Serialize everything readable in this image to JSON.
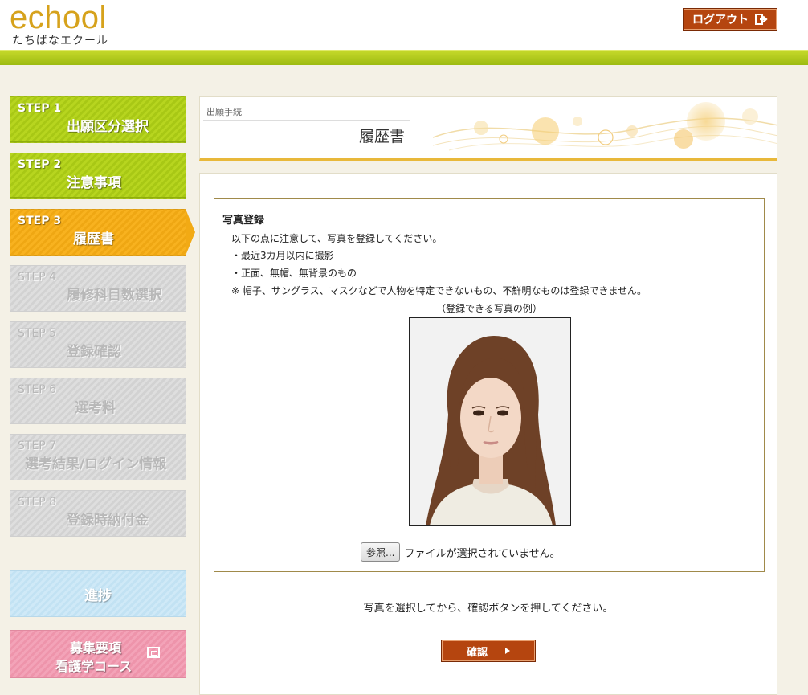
{
  "header": {
    "logo_main": "echool",
    "logo_sub": "たちばなエクール",
    "logout_label": "ログアウト"
  },
  "sidebar": {
    "steps": [
      {
        "num": "STEP 1",
        "title": "出願区分選択",
        "state": "done"
      },
      {
        "num": "STEP 2",
        "title": "注意事項",
        "state": "done"
      },
      {
        "num": "STEP 3",
        "title": "履歴書",
        "state": "current"
      },
      {
        "num": "STEP 4",
        "title": "履修科目数選択",
        "state": "future"
      },
      {
        "num": "STEP 5",
        "title": "登録確認",
        "state": "future"
      },
      {
        "num": "STEP 6",
        "title": "選考料",
        "state": "future"
      },
      {
        "num": "STEP 7",
        "title": "選考結果/ログイン情報",
        "state": "future"
      },
      {
        "num": "STEP 8",
        "title": "登録時納付金",
        "state": "future"
      }
    ],
    "progress_label": "進捗",
    "recruit_line1": "募集要項",
    "recruit_line2": "看護学コース"
  },
  "title_box": {
    "breadcrumb": "出願手続",
    "page_title": "履歴書"
  },
  "photo_section": {
    "title": "写真登録",
    "intro": "以下の点に注意して、写真を登録してください。",
    "rule1": "・最近3カ月以内に撮影",
    "rule2": "・正面、無帽、無背景のもの",
    "warning": "※ 帽子、サングラス、マスクなどで人物を特定できないもの、不鮮明なものは登録できません。",
    "example_label": "（登録できる写真の例）",
    "browse_label": "参照...",
    "file_status": "ファイルが選択されていません。"
  },
  "instruction": "写真を選択してから、確認ボタンを押してください。",
  "confirm_label": "確認",
  "colors": {
    "brand_gold": "#d6a21c",
    "green_band": "#a8c815",
    "step_done": "#b7d51f",
    "step_current": "#f8b21f",
    "action_button": "#b5450f"
  }
}
